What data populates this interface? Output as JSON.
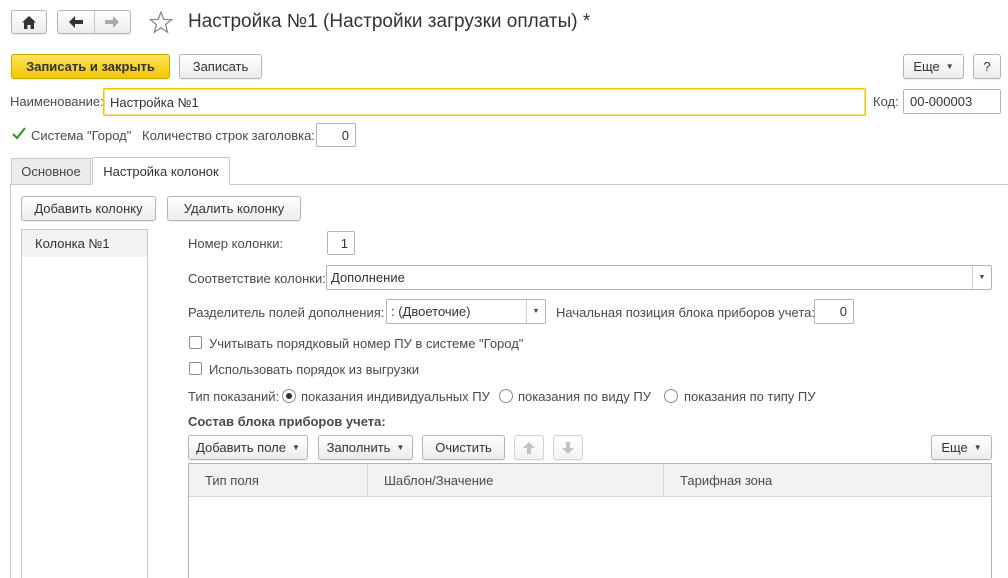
{
  "window": {
    "title": "Настройка №1 (Настройки загрузки оплаты) *",
    "home_icon": "home-icon",
    "back_icon": "arrow-left-icon",
    "forward_icon": "arrow-right-icon",
    "star_icon": "star-icon"
  },
  "toolbar": {
    "save_close_label": "Записать и закрыть",
    "save_label": "Записать",
    "more_label": "Еще",
    "help_label": "?"
  },
  "form": {
    "name_label": "Наименование:",
    "name_value": "Настройка №1",
    "code_label": "Код:",
    "code_value": "00-000003",
    "system_checkbox_label": "Система \"Город\"",
    "system_checked": true,
    "header_rows_label": "Количество строк заголовка:",
    "header_rows_value": "0"
  },
  "tabs": [
    {
      "label": "Основное",
      "active": false
    },
    {
      "label": "Настройка колонок",
      "active": true
    }
  ],
  "columns_panel": {
    "add_column_label": "Добавить колонку",
    "delete_column_label": "Удалить колонку",
    "list": [
      "Колонка №1"
    ]
  },
  "column_settings": {
    "number_label": "Номер колонки:",
    "number_value": "1",
    "mapping_label": "Соответствие колонки:",
    "mapping_value": "Дополнение",
    "separator_label": "Разделитель полей дополнения:",
    "separator_value": ": (Двоеточие)",
    "start_pos_label": "Начальная позиция блока приборов учета:",
    "start_pos_value": "0",
    "seq_number_label": "Учитывать порядковый номер ПУ в системе \"Город\"",
    "seq_number_checked": false,
    "use_order_label": "Использовать порядок из выгрузки",
    "use_order_checked": false,
    "readings_type_label": "Тип показаний:",
    "readings_options": [
      {
        "label": "показания индивидуальных ПУ",
        "selected": true
      },
      {
        "label": "показания по виду ПУ",
        "selected": false
      },
      {
        "label": "показания по типу ПУ",
        "selected": false
      }
    ]
  },
  "meter_block": {
    "title": "Состав блока приборов учета:",
    "add_field_label": "Добавить поле",
    "fill_label": "Заполнить",
    "clear_label": "Очистить",
    "up_icon": "arrow-up-icon",
    "down_icon": "arrow-down-icon",
    "more_label": "Еще",
    "table_headers": [
      "Тип поля",
      "Шаблон/Значение",
      "Тарифная зона"
    ]
  }
}
